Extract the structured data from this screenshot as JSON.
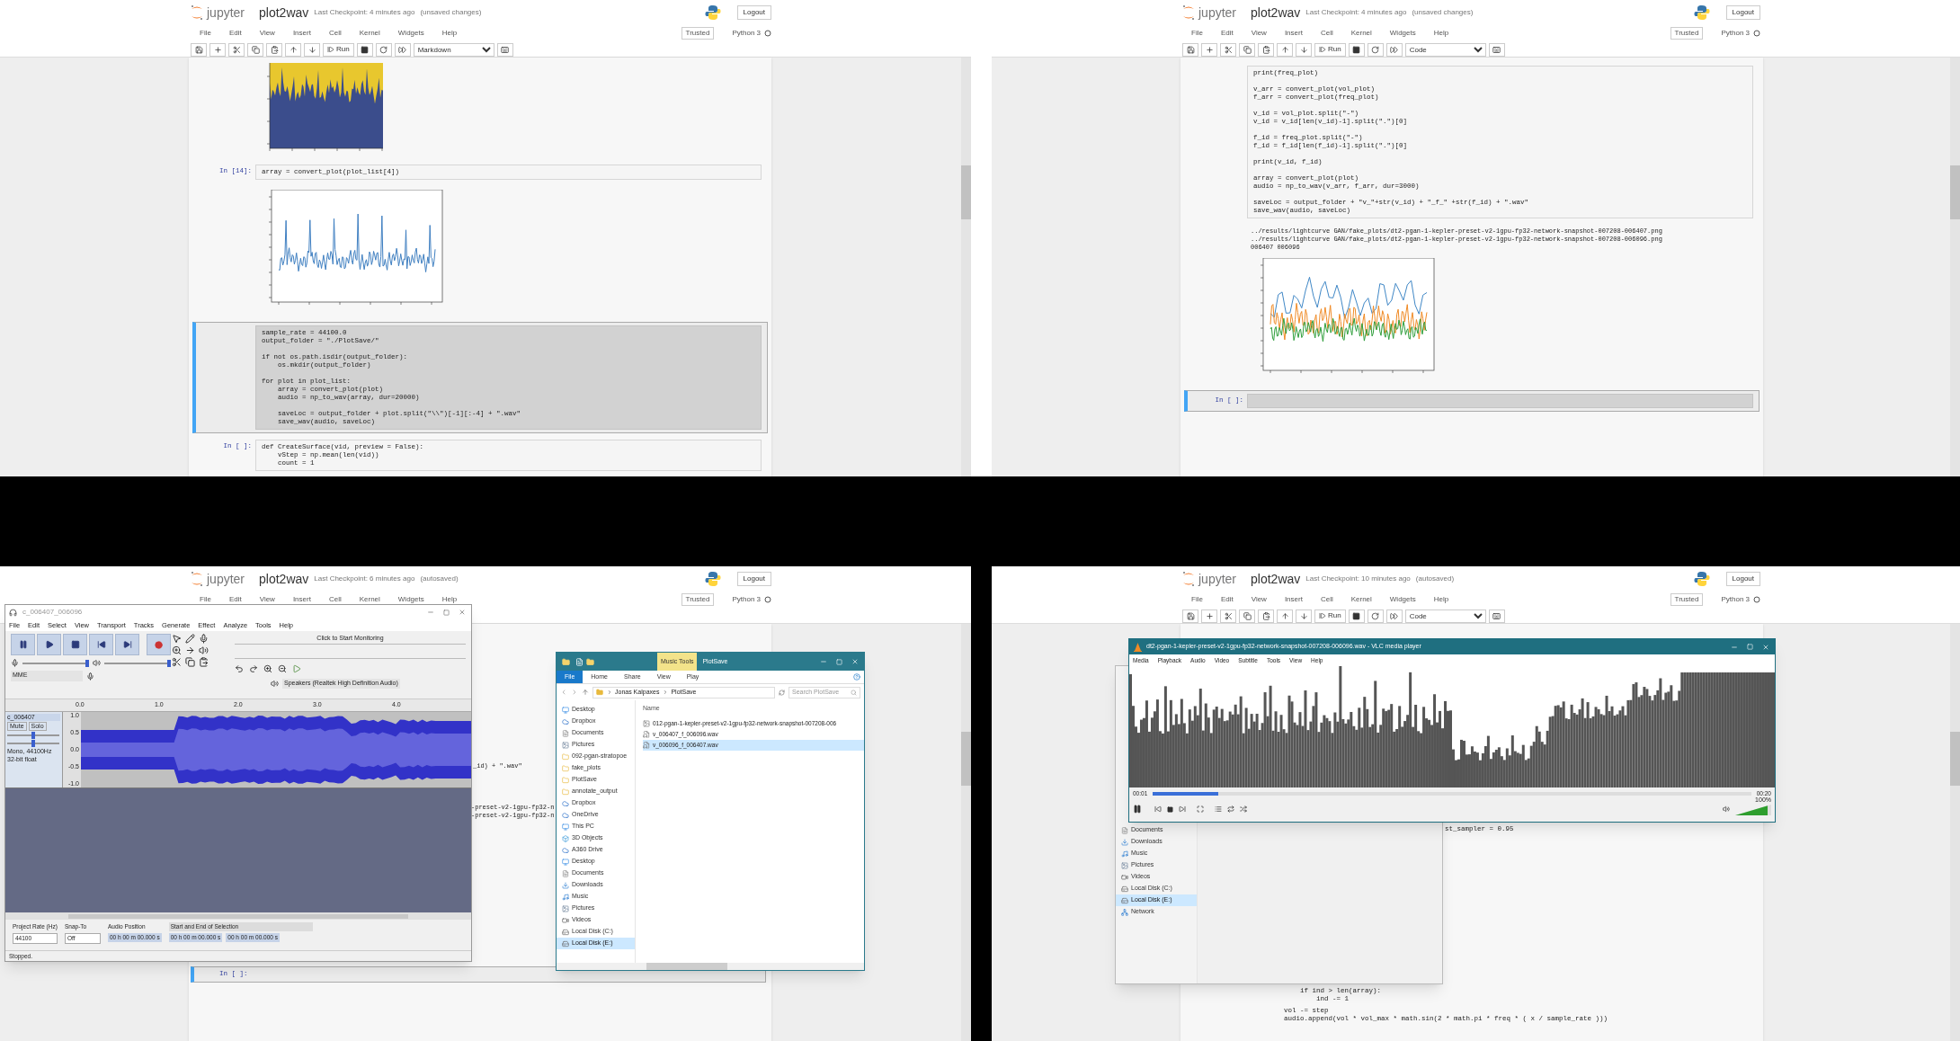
{
  "panels": [
    {
      "kind": "notebook",
      "header": {
        "logo": "jupyter",
        "name": "plot2wav",
        "checkpoint": "Last Checkpoint: 4 minutes ago",
        "status": "(unsaved changes)",
        "logout": "Logout",
        "menus": [
          "File",
          "Edit",
          "View",
          "Insert",
          "Cell",
          "Kernel",
          "Widgets",
          "Help"
        ],
        "trusted": "Trusted",
        "kernel": "Python 3",
        "run": "Run",
        "cell_type": "Markdown"
      },
      "cells": [
        {
          "kind": "stacked_chart"
        },
        {
          "kind": "code",
          "prompt": "In [14]:",
          "selected": false,
          "blocks": [
            [
              "array = convert_plot(plot_list[4])"
            ]
          ]
        },
        {
          "kind": "line_chart"
        },
        {
          "kind": "code",
          "selected": true,
          "blocks": [
            [
              "sample_rate = 44100.0",
              "output_folder = \"./PlotSave/\""
            ],
            [
              "if not os.path.isdir(output_folder):",
              "    os.mkdir(output_folder)"
            ],
            [
              "for plot in plot_list:",
              "    array = convert_plot(plot)",
              "    audio = np_to_wav(array, dur=20000)"
            ],
            [
              "    saveLoc = output_folder + plot.split(\"\\\\\")[-1][:-4] + \".wav\"",
              "    save_wav(audio, saveLoc)"
            ]
          ]
        },
        {
          "kind": "code",
          "prompt": "In [ ]:",
          "selected": false,
          "blocks": [
            [
              "def CreateSurface(vid, preview = False):",
              "    vStep = np.mean(len(vid))",
              "    count = 1"
            ]
          ]
        }
      ]
    },
    {
      "kind": "notebook",
      "header": {
        "logo": "jupyter",
        "name": "plot2wav",
        "checkpoint": "Last Checkpoint: 4 minutes ago",
        "status": "(unsaved changes)",
        "logout": "Logout",
        "menus": [
          "File",
          "Edit",
          "View",
          "Insert",
          "Cell",
          "Kernel",
          "Widgets",
          "Help"
        ],
        "trusted": "Trusted",
        "kernel": "Python 3",
        "run": "Run",
        "cell_type": "Code"
      },
      "cells": [
        {
          "kind": "code",
          "selected": false,
          "blocks": [
            [
              "print(freq_plot)"
            ],
            [
              "v_arr = convert_plot(vol_plot)",
              "f_arr = convert_plot(freq_plot)"
            ],
            [
              "v_id = vol_plot.split(\"-\")",
              "v_id = v_id[len(v_id)-1].split(\".\")[0]"
            ],
            [
              "f_id = freq_plot.split(\"-\")",
              "f_id = f_id[len(f_id)-1].split(\".\")[0]"
            ],
            [
              "print(v_id, f_id)"
            ],
            [
              "array = convert_plot(plot)",
              "audio = np_to_wav(v_arr, f_arr, dur=3000)"
            ],
            [
              "saveLoc = output_folder + \"v_\"+str(v_id) + \"_f_\" +str(f_id) + \".wav\"",
              "save_wav(audio, saveLoc)"
            ]
          ]
        },
        {
          "kind": "output",
          "lines": [
            "../results/lightcurve GAN/fake_plots/dt2-pgan-1-kepler-preset-v2-1gpu-fp32-network-snapshot-007208-006407.png",
            "../results/lightcurve GAN/fake_plots/dt2-pgan-1-kepler-preset-v2-1gpu-fp32-network-snapshot-007208-006096.png",
            "006407 006096"
          ]
        },
        {
          "kind": "multi_line_chart"
        },
        {
          "kind": "code",
          "prompt": "In [ ]:",
          "selected": true
        }
      ]
    },
    {
      "kind": "covered",
      "header": {
        "logo": "jupyter",
        "name": "plot2wav",
        "checkpoint": "Last Checkpoint: 6 minutes ago",
        "status": "(autosaved)",
        "logout": "Logout",
        "menus": [
          "File",
          "Edit",
          "View",
          "Insert",
          "Cell",
          "Kernel",
          "Widgets",
          "Help"
        ],
        "trusted": "Trusted",
        "kernel": "Python 3"
      },
      "fragments": [
        {
          "lines": [
            "_id) + \".wav\""
          ]
        },
        {
          "lines": [
            "-preset-v2-1gpu-fp32-n",
            "-preset-v2-1gpu-fp32-n"
          ]
        },
        {
          "prompt": "In [ ]:"
        }
      ],
      "windows": [
        {
          "kind": "audacity",
          "title": "c_006407_006096",
          "menus": [
            "File",
            "Edit",
            "Select",
            "View",
            "Transport",
            "Tracks",
            "Generate",
            "Effect",
            "Analyze",
            "Tools",
            "Help"
          ],
          "meter_hint": "Click to Start Monitoring",
          "recording_volume": {
            "level": 1
          },
          "playback_volume": {
            "level": 1
          },
          "host": "MME",
          "output_device": "Speakers (Realtek High Definition Audio)",
          "ruler": [
            "0.0",
            "1.0",
            "2.0",
            "3.0",
            "4.0"
          ],
          "track": {
            "name": "c_006407",
            "mute": "Mute",
            "solo": "Solo",
            "gain": {
              "level": 0.5
            },
            "pan": {
              "level": 0.5
            },
            "info": "Mono, 44100Hz",
            "format": "32-bit float",
            "scale": [
              "1.0",
              "0.5",
              "0.0",
              "-0.5",
              "-1.0"
            ]
          },
          "rate_label": "Project Rate (Hz)",
          "rate": "44100",
          "snap_label": "Snap-To",
          "snap": "Off",
          "position_label": "Audio Position",
          "position": "00 h 00 m 00.000 s",
          "selection_label": "Start and End of Selection",
          "selection_start": "00 h 00 m 00.000 s",
          "selection_end": "00 h 00 m 00.000 s",
          "status": "Stopped."
        },
        {
          "kind": "explorer",
          "context_tab": "Music Tools",
          "title": "PlotSave",
          "ribbon": [
            {
              "label": "File",
              "selected": true
            },
            {
              "label": "Home",
              "selected": false
            },
            {
              "label": "Share",
              "selected": false
            },
            {
              "label": "View",
              "selected": false
            },
            {
              "label": "Play",
              "selected": false
            }
          ],
          "path": [
            "Jonas Kalpaxes",
            "PlotSave"
          ],
          "search": "Search PlotSave",
          "column": "Name",
          "nav": [
            {
              "label": "Desktop",
              "kind": "desktop",
              "selected": false
            },
            {
              "label": "Dropbox",
              "kind": "cloud",
              "selected": false
            },
            {
              "label": "Documents",
              "kind": "doc",
              "selected": false
            },
            {
              "label": "Pictures",
              "kind": "image",
              "selected": false
            },
            {
              "label": "092-pgan-stratopoe",
              "kind": "folder",
              "selected": false
            },
            {
              "label": "fake_plots",
              "kind": "folder",
              "selected": false
            },
            {
              "label": "PlotSave",
              "kind": "folder",
              "selected": false
            },
            {
              "label": "annotate_output",
              "kind": "folder",
              "selected": false
            },
            {
              "label": "Dropbox",
              "kind": "cloud",
              "selected": false
            },
            {
              "label": "OneDrive",
              "kind": "cloud",
              "selected": false
            },
            {
              "label": "This PC",
              "kind": "desktop",
              "selected": false
            },
            {
              "label": "3D Objects",
              "kind": "box",
              "selected": false
            },
            {
              "label": "A360 Drive",
              "kind": "cloud",
              "selected": false
            },
            {
              "label": "Desktop",
              "kind": "desktop",
              "selected": false
            },
            {
              "label": "Documents",
              "kind": "doc",
              "selected": false
            },
            {
              "label": "Downloads",
              "kind": "download",
              "selected": false
            },
            {
              "label": "Music",
              "kind": "music",
              "selected": false
            },
            {
              "label": "Pictures",
              "kind": "image",
              "selected": false
            },
            {
              "label": "Videos",
              "kind": "video",
              "selected": false
            },
            {
              "label": "Local Disk (C:)",
              "kind": "drive",
              "selected": false
            },
            {
              "label": "Local Disk (E:)",
              "kind": "drive",
              "selected": true
            }
          ],
          "files": [
            {
              "name": "012-pgan-1-kepler-preset-v2-1gpu-fp32-network-snapshot-007208-006",
              "kind": "image",
              "selected": false
            },
            {
              "name": "v_006407_f_006096.wav",
              "kind": "audio",
              "selected": false
            },
            {
              "name": "v_006096_f_006407.wav",
              "kind": "audio",
              "selected": true
            }
          ]
        }
      ]
    },
    {
      "kind": "covered",
      "header": {
        "logo": "jupyter",
        "name": "plot2wav",
        "checkpoint": "Last Checkpoint: 10 minutes ago",
        "status": "(autosaved)",
        "logout": "Logout",
        "menus": [
          "File",
          "Edit",
          "View",
          "Insert",
          "Cell",
          "Kernel",
          "Widgets",
          "Help"
        ],
        "trusted": "Trusted",
        "kernel": "Python 3",
        "run": "Run",
        "cell_type": "Code"
      },
      "fragments": [
        {
          "lines": [
            "st_sampler = 0.95"
          ]
        },
        {
          "lines": [
            "    if ind > len(array):",
            "        ind -= 1"
          ]
        },
        {
          "lines": [
            "vol -= step",
            "audio.append(vol * vol_max * math.sin(2 * math.pi * freq * ( x / sample_rate )))"
          ]
        }
      ],
      "windows": [
        {
          "kind": "vlc",
          "title": "dt2-pgan-1-kepler-preset-v2-1gpu-fp32-network-snapshot-007208-006096.wav - VLC media player",
          "menus": [
            "Media",
            "Playback",
            "Audio",
            "Video",
            "Subtitle",
            "Tools",
            "View",
            "Help"
          ],
          "elapsed": "00:01",
          "total": "00:20",
          "progress": {
            "level": 0.11
          },
          "volume": {
            "level": 0.9,
            "reading": "100%"
          }
        },
        {
          "kind": "explorer_back",
          "nav": [
            {
              "label": "Documents",
              "kind": "doc",
              "selected": false
            },
            {
              "label": "Downloads",
              "kind": "download",
              "selected": false
            },
            {
              "label": "Music",
              "kind": "music",
              "selected": false
            },
            {
              "label": "Pictures",
              "kind": "image",
              "selected": false
            },
            {
              "label": "Videos",
              "kind": "video",
              "selected": false
            },
            {
              "label": "Local Disk (C:)",
              "kind": "drive",
              "selected": false
            },
            {
              "label": "Local Disk (E:)",
              "kind": "drive",
              "selected": true
            },
            {
              "label": "Network",
              "kind": "network",
              "selected": false
            }
          ]
        }
      ]
    }
  ]
}
